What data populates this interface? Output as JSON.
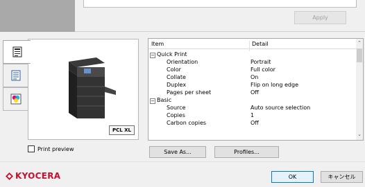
{
  "header": {
    "apply_label": "Apply"
  },
  "side_tabs": [
    {
      "icon": "printer-settings-icon"
    },
    {
      "icon": "document-layout-icon"
    },
    {
      "icon": "color-icon"
    }
  ],
  "preview": {
    "badge": "PCL XL",
    "checkbox_label": "Print preview",
    "checked": false
  },
  "tree": {
    "headers": {
      "item": "Item",
      "detail": "Detail"
    },
    "rows": [
      {
        "type": "group",
        "label": "Quick Print",
        "expander": "−"
      },
      {
        "label": "Orientation",
        "value": "Portrait"
      },
      {
        "label": "Color",
        "value": "Full color"
      },
      {
        "label": "Collate",
        "value": "On"
      },
      {
        "label": "Duplex",
        "value": "Flip on long edge"
      },
      {
        "label": "Pages per sheet",
        "value": "Off"
      },
      {
        "type": "group",
        "label": "Basic",
        "expander": "−"
      },
      {
        "label": "Source",
        "value": "Auto source selection"
      },
      {
        "label": "Copies",
        "value": "1"
      },
      {
        "label": "Carbon copies",
        "value": "Off"
      }
    ]
  },
  "buttons": {
    "save_as": "Save As...",
    "profiles": "Profiles...",
    "ok": "OK",
    "cancel": "キャンセル"
  },
  "brand": {
    "name": "KYOCERA",
    "color": "#c8102e"
  }
}
